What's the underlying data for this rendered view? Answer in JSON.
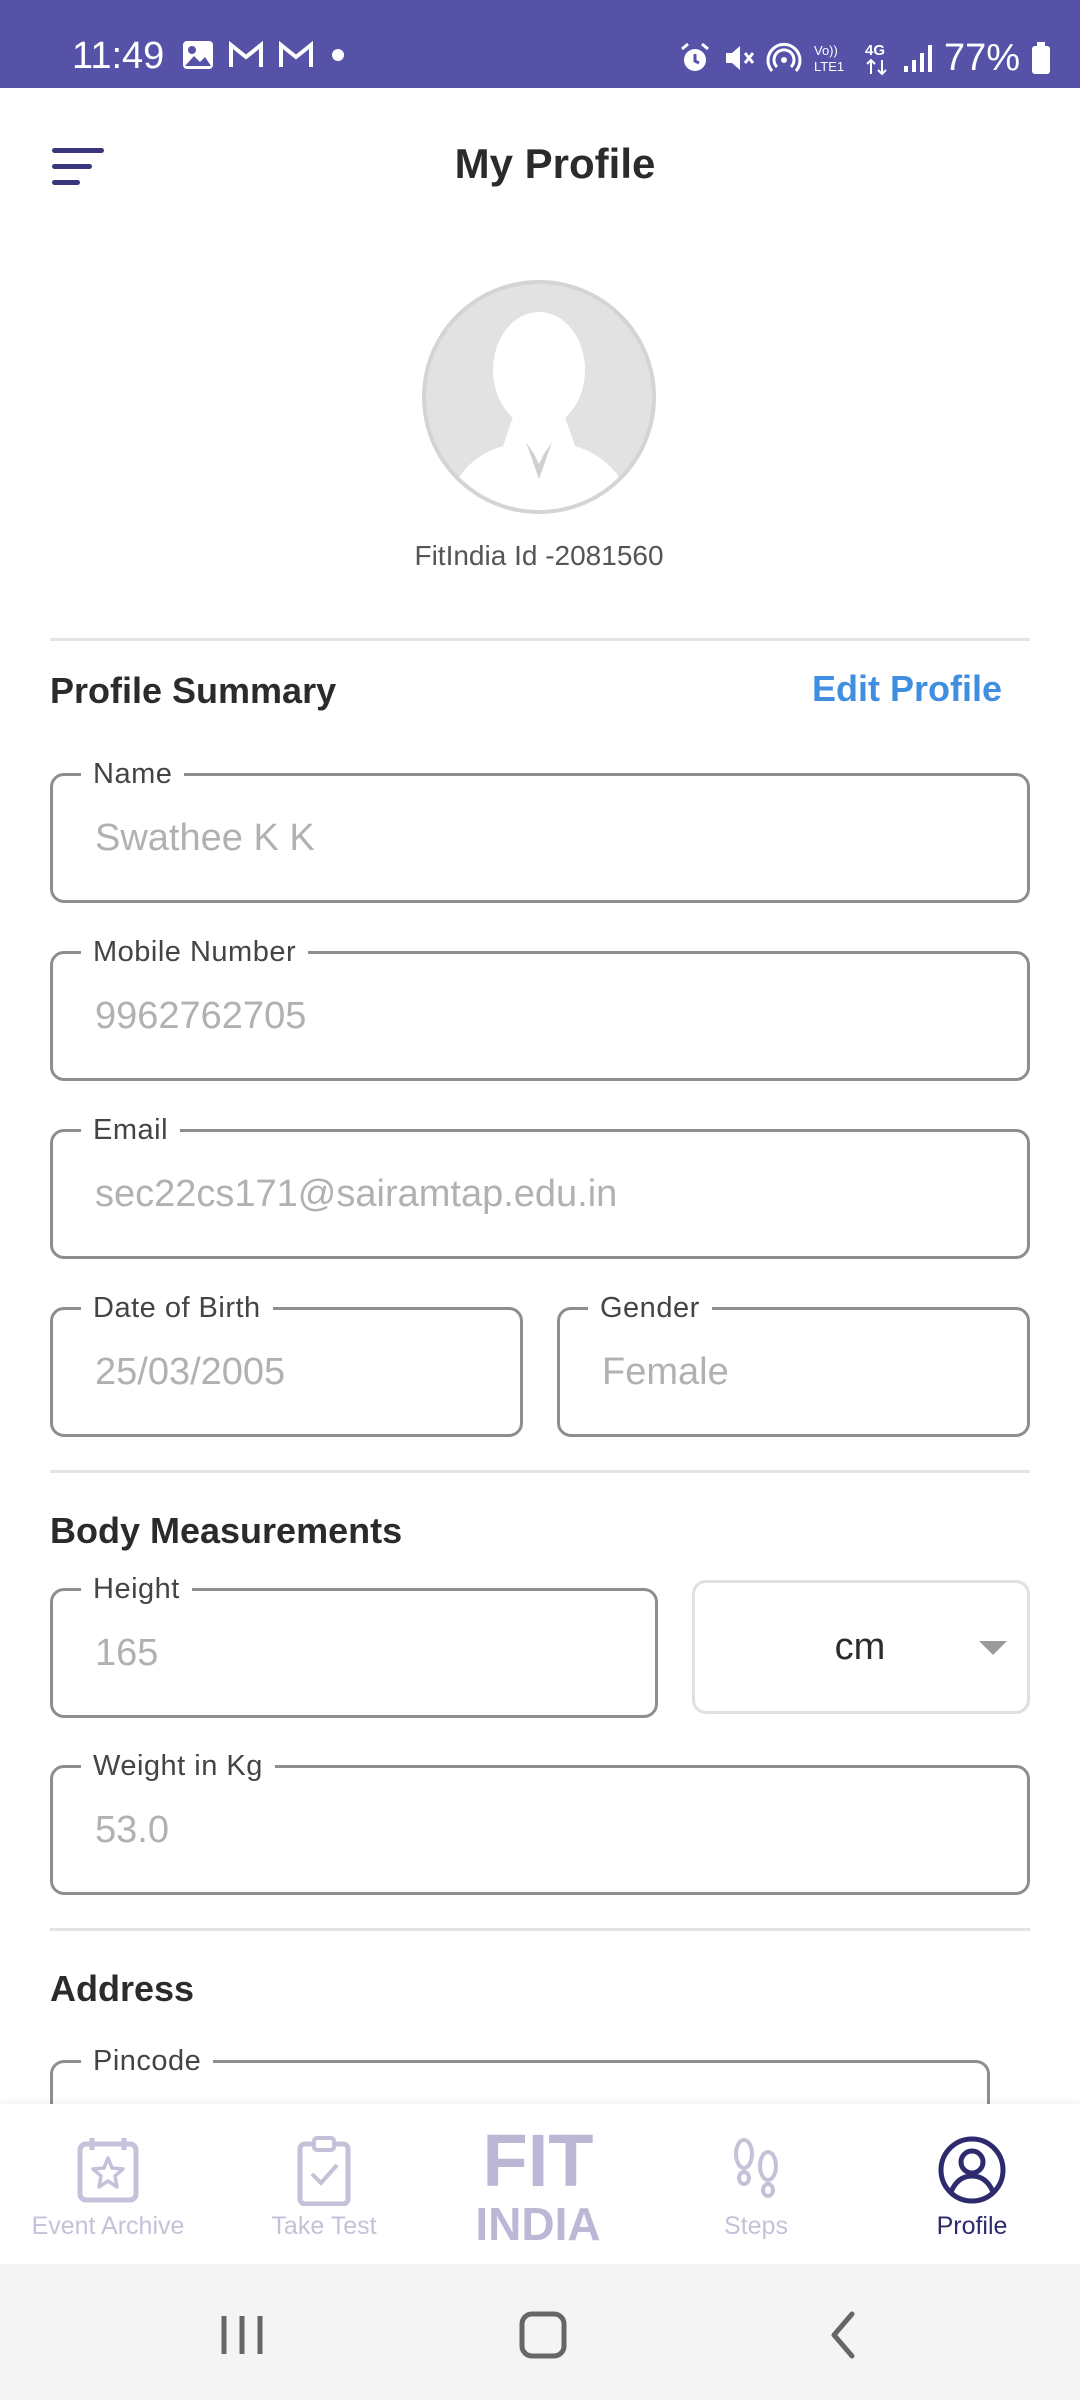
{
  "status_bar": {
    "time": "11:49",
    "battery": "77%",
    "left_icons": [
      "gallery-icon",
      "gmail-icon",
      "gmail-icon",
      "dot-icon"
    ],
    "right_icons": [
      "alarm-icon",
      "mute-icon",
      "hotspot-icon",
      "volte-icon",
      "4g-icon",
      "signal-icon",
      "battery-icon"
    ],
    "color": "#5652a8"
  },
  "header": {
    "title": "My Profile"
  },
  "profile": {
    "fitindia_id": "FitIndia Id -2081560"
  },
  "summary": {
    "title": "Profile Summary",
    "edit_label": "Edit Profile",
    "fields": {
      "name": {
        "label": "Name",
        "value": "Swathee K K"
      },
      "mobile": {
        "label": "Mobile Number",
        "value": "9962762705"
      },
      "email": {
        "label": "Email",
        "value": "sec22cs171@sairamtap.edu.in"
      },
      "dob": {
        "label": "Date of Birth",
        "value": "25/03/2005"
      },
      "gender": {
        "label": "Gender",
        "value": "Female"
      }
    }
  },
  "body": {
    "title": "Body Measurements",
    "height": {
      "label": "Height",
      "value": "165"
    },
    "unit": "cm",
    "weight": {
      "label": "Weight in Kg",
      "value": "53.0"
    }
  },
  "address": {
    "title": "Address",
    "pincode": {
      "label": "Pincode",
      "value": ""
    }
  },
  "bottom_nav": {
    "items": [
      {
        "label": "Event Archive",
        "icon": "calendar-star-icon"
      },
      {
        "label": "Take Test",
        "icon": "clipboard-check-icon"
      },
      {
        "label": "",
        "icon": "fit-india-logo"
      },
      {
        "label": "Steps",
        "icon": "footsteps-icon"
      },
      {
        "label": "Profile",
        "icon": "profile-icon"
      }
    ],
    "logo_text_top": "FIT",
    "logo_text_bottom": "INDIA",
    "active": "Profile"
  },
  "colors": {
    "accent": "#5652a8",
    "link": "#3f8ee0",
    "active_nav": "#2e2a6e",
    "inactive_nav": "#c4c2d8"
  }
}
